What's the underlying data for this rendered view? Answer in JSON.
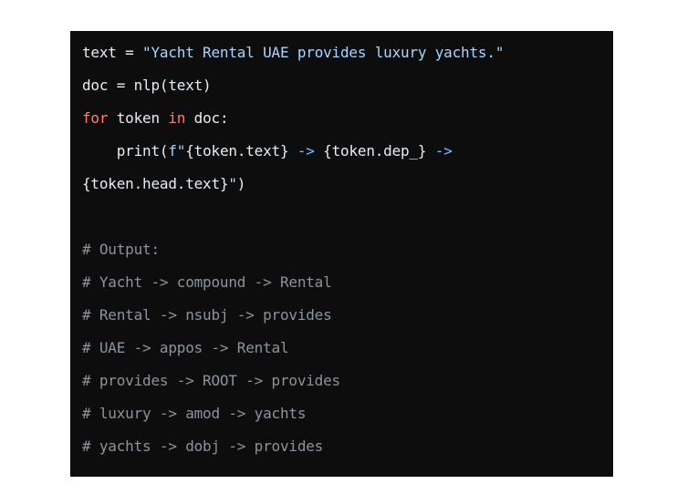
{
  "code_block": {
    "language": "python",
    "colors": {
      "background": "#0d0d0d",
      "plain": "#e6edf3",
      "keyword": "#ff7b72",
      "string": "#a5d6ff",
      "function": "#ffa657",
      "comment": "#8b949e"
    },
    "lines": [
      {
        "tokens": [
          {
            "type": "plain",
            "text": "text = "
          },
          {
            "type": "string",
            "text": "\"Yacht Rental UAE provides luxury yachts.\""
          }
        ]
      },
      {
        "tokens": [
          {
            "type": "plain",
            "text": "doc = nlp(text)"
          }
        ]
      },
      {
        "tokens": [
          {
            "type": "keyword",
            "text": "for"
          },
          {
            "type": "plain",
            "text": " token "
          },
          {
            "type": "keyword",
            "text": "in"
          },
          {
            "type": "plain",
            "text": " doc:"
          }
        ]
      },
      {
        "tokens": [
          {
            "type": "plain",
            "text": "    "
          },
          {
            "type": "function",
            "text": "print"
          },
          {
            "type": "plain",
            "text": "("
          },
          {
            "type": "string",
            "text": "f\""
          },
          {
            "type": "plain",
            "text": "{token.text}"
          },
          {
            "type": "arrow",
            "text": " -> "
          },
          {
            "type": "plain",
            "text": "{token.dep_}"
          },
          {
            "type": "arrow",
            "text": " ->"
          }
        ]
      },
      {
        "tokens": [
          {
            "type": "plain",
            "text": "{token.head.text}"
          },
          {
            "type": "string",
            "text": "\""
          },
          {
            "type": "plain",
            "text": ")"
          }
        ]
      },
      {
        "tokens": []
      },
      {
        "tokens": [
          {
            "type": "comment",
            "text": "# Output:"
          }
        ]
      },
      {
        "tokens": [
          {
            "type": "comment",
            "text": "# Yacht -> compound -> Rental"
          }
        ]
      },
      {
        "tokens": [
          {
            "type": "comment",
            "text": "# Rental -> nsubj -> provides"
          }
        ]
      },
      {
        "tokens": [
          {
            "type": "comment",
            "text": "# UAE -> appos -> Rental"
          }
        ]
      },
      {
        "tokens": [
          {
            "type": "comment",
            "text": "# provides -> ROOT -> provides"
          }
        ]
      },
      {
        "tokens": [
          {
            "type": "comment",
            "text": "# luxury -> amod -> yachts"
          }
        ]
      },
      {
        "tokens": [
          {
            "type": "comment",
            "text": "# yachts -> dobj -> provides"
          }
        ]
      }
    ]
  }
}
